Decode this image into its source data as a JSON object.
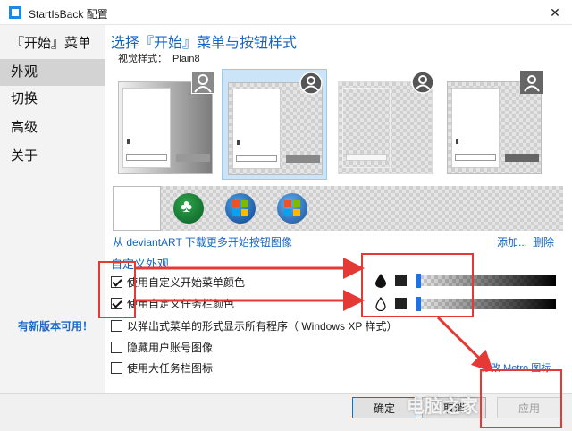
{
  "window": {
    "title": "StartIsBack 配置"
  },
  "sidebar": {
    "items": [
      {
        "label": "『开始』菜单"
      },
      {
        "label": "外观"
      },
      {
        "label": "切换"
      },
      {
        "label": "高级"
      },
      {
        "label": "关于"
      }
    ],
    "active_index": 1,
    "update_link": "有新版本可用！"
  },
  "main": {
    "heading": "选择『开始』菜单与按钮样式",
    "visual_style_label": "视觉样式：",
    "visual_style_value": "Plain8",
    "thumbnails": [
      {
        "name": "style-1",
        "selected": false
      },
      {
        "name": "style-2",
        "selected": true
      },
      {
        "name": "style-3",
        "selected": false
      },
      {
        "name": "style-4",
        "selected": false
      }
    ],
    "download_link": "从 deviantART 下载更多开始按钮图像",
    "add_link": "添加...",
    "delete_link": "删除",
    "section_label": "自定义外观",
    "options": [
      {
        "label": "使用自定义开始菜单颜色",
        "checked": true
      },
      {
        "label": "使用自定义任务栏颜色",
        "checked": true
      },
      {
        "label": "以弹出式菜单的形式显示所有程序（ Windows XP 样式）",
        "checked": false
      },
      {
        "label": "隐藏用户账号图像",
        "checked": false
      },
      {
        "label": "使用大任务栏图标",
        "checked": false
      }
    ],
    "color_sliders": [
      {
        "icon": "drop-filled-icon",
        "swatch": "#222222",
        "level": 0
      },
      {
        "icon": "drop-outline-icon",
        "swatch": "#222222",
        "level": 0
      }
    ],
    "metro_link": "修改 Metro 图标"
  },
  "footer": {
    "ok": "确定",
    "cancel": "取消",
    "apply": "应用"
  },
  "watermark": "电脑之家",
  "colors": {
    "accent": "#1565c0",
    "highlight": "#e53935",
    "selected_bg": "#cce4f7"
  }
}
